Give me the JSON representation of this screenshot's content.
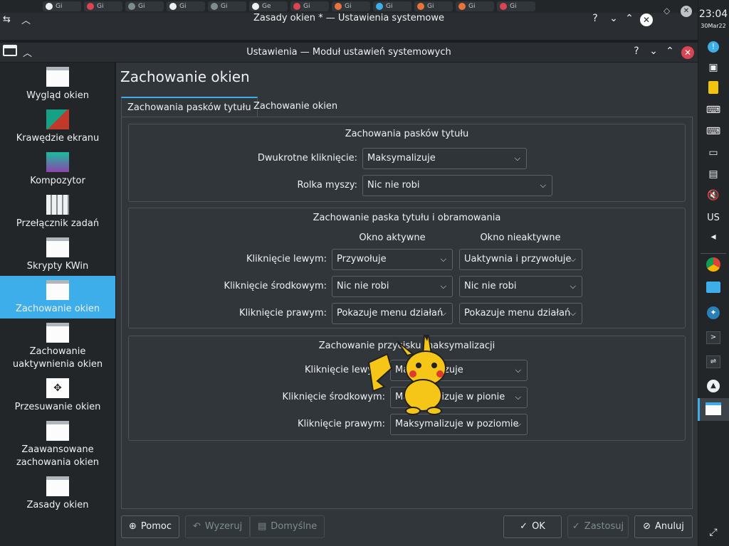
{
  "back_window": {
    "title": "Zasady okien * — Ustawienia systemowe",
    "tab_labels": [
      "Gi",
      "Gi",
      "Gi",
      "Gi",
      "Gi",
      "Gi",
      "Ge",
      "Gi",
      "Gi",
      "Gi",
      "Gi",
      "Gi",
      "Gi"
    ]
  },
  "window": {
    "title": "Ustawienia — Moduł ustawień systemowych",
    "help_glyph": "?",
    "minimize_glyph": "⌄",
    "maximize_glyph": "⌃",
    "close_glyph": "✕"
  },
  "sidebar": {
    "items": [
      {
        "label": "Wygląd okien",
        "icon": "window-decoration-icon"
      },
      {
        "label": "Krawędzie ekranu",
        "icon": "screen-edges-icon"
      },
      {
        "label": "Kompozytor",
        "icon": "compositor-icon"
      },
      {
        "label": "Przełącznik zadań",
        "icon": "task-switcher-icon"
      },
      {
        "label": "Skrypty KWin",
        "icon": "kwin-scripts-icon"
      },
      {
        "label": "Zachowanie okien",
        "icon": "window-behavior-icon",
        "selected": true
      },
      {
        "label": "Zachowanie uaktywnienia okien",
        "icon": "activation-icon"
      },
      {
        "label": "Przesuwanie okien",
        "icon": "move-window-icon"
      },
      {
        "label": "Zaawansowane zachowania okien",
        "icon": "advanced-window-icon"
      },
      {
        "label": "Zasady okien",
        "icon": "window-rules-icon"
      }
    ]
  },
  "page": {
    "title": "Zachowanie okien",
    "tabs": [
      "Zachowania pasków tytułu",
      "Zachowanie okien"
    ]
  },
  "group1": {
    "title": "Zachowania pasków tytułu",
    "double_click_label": "Dwukrotne kliknięcie:",
    "double_click_value": "Maksymalizuje",
    "wheel_label": "Rolka myszy:",
    "wheel_value": "Nic nie robi"
  },
  "group2": {
    "title": "Zachowanie paska tytułu i obramowania",
    "col_active": "Okno aktywne",
    "col_inactive": "Okno nieaktywne",
    "rows": [
      {
        "label": "Kliknięcie lewym:",
        "active": "Przywołuje",
        "inactive": "Uaktywnia i przywołuje"
      },
      {
        "label": "Kliknięcie środkowym:",
        "active": "Nic nie robi",
        "inactive": "Nic nie robi"
      },
      {
        "label": "Kliknięcie prawym:",
        "active": "Pokazuje menu działań",
        "inactive": "Pokazuje menu działań"
      }
    ]
  },
  "group3": {
    "title": "Zachowanie przycisku maksymalizacji",
    "rows": [
      {
        "label": "Kliknięcie lewym:",
        "value": "Maksymalizuje"
      },
      {
        "label": "Kliknięcie środkowym:",
        "value": "Maksymalizuje w pionie"
      },
      {
        "label": "Kliknięcie prawym:",
        "value": "Maksymalizuje w poziomie"
      }
    ]
  },
  "buttons": {
    "help": "Pomoc",
    "reset": "Wyzeruj",
    "defaults": "Domyślne",
    "ok": "OK",
    "apply": "Zastosuj",
    "cancel": "Anuluj"
  },
  "panel": {
    "time": "23:04",
    "date": "30Mar22",
    "keyboard_layout": "US"
  },
  "colors": {
    "accent": "#3daee9",
    "background": "#31363b",
    "sidebar": "#232629",
    "close_red": "#da4453"
  }
}
